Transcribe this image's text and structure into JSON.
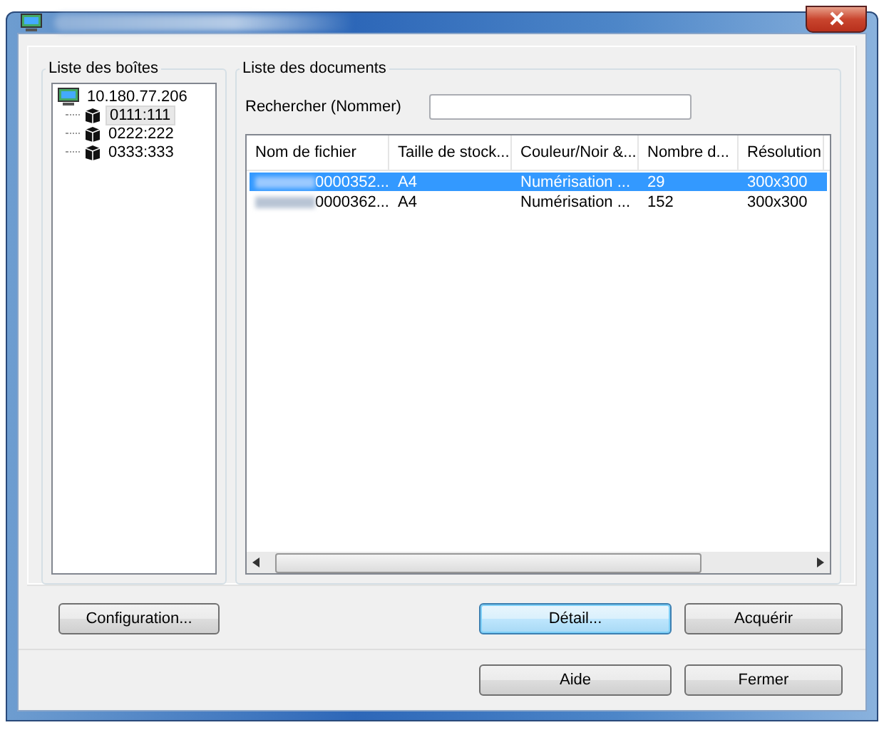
{
  "boxes": {
    "label": "Liste des boîtes",
    "tree": [
      {
        "label": "10.180.77.206",
        "selected": false,
        "children": [
          {
            "label": "0111:111",
            "selected": true
          },
          {
            "label": "0222:222",
            "selected": false
          },
          {
            "label": "0333:333",
            "selected": false
          }
        ]
      }
    ]
  },
  "documents": {
    "label": "Liste des documents",
    "search": {
      "label": "Rechercher (Nommer)"
    },
    "table": {
      "columns": [
        "Nom de fichier",
        "Taille de stock...",
        "Couleur/Noir &...",
        "Nombre d...",
        "Résolution"
      ],
      "rows": [
        {
          "selected": true,
          "cells": [
            "0000352...",
            "A4",
            "Numérisation ...",
            "29",
            "300x300"
          ]
        },
        {
          "selected": false,
          "cells": [
            "0000362...",
            "A4",
            "Numérisation ...",
            "152",
            "300x300"
          ]
        }
      ]
    }
  },
  "buttons": [
    {
      "label": "Configuration...",
      "kind": "left",
      "focused": false
    },
    {
      "label": "Détail...",
      "kind": "right",
      "focused": true
    },
    {
      "label": "Acquérir",
      "kind": "right",
      "focused": false
    }
  ],
  "footer_buttons": [
    {
      "label": "Aide"
    },
    {
      "label": "Fermer"
    }
  ]
}
